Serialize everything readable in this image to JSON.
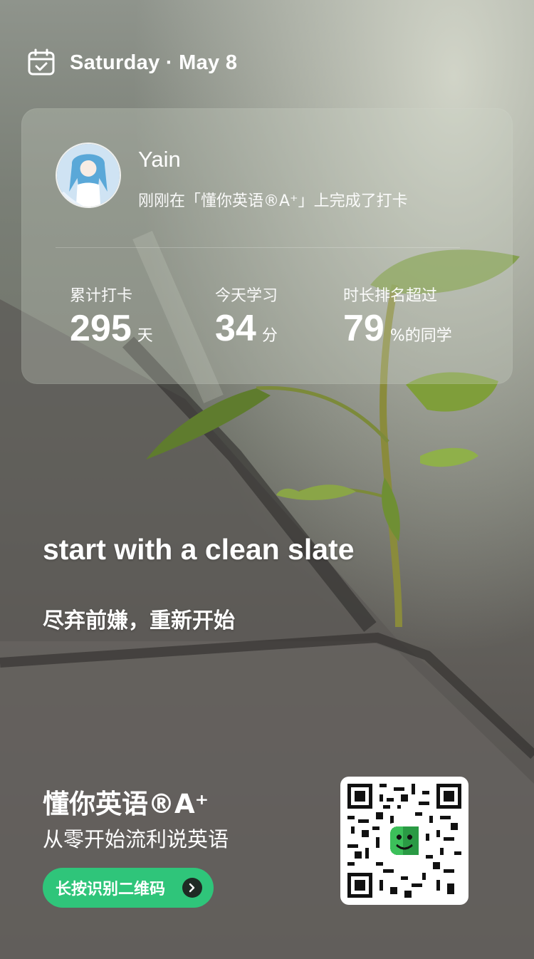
{
  "header": {
    "date": "Saturday · May 8",
    "calendar_icon": "calendar-check-icon"
  },
  "card": {
    "username": "Yain",
    "checkin_message": "刚刚在「懂你英语®A⁺」上完成了打卡",
    "stats": [
      {
        "label": "累计打卡",
        "value": "295",
        "unit": "天"
      },
      {
        "label": "今天学习",
        "value": "34",
        "unit": "分"
      },
      {
        "label": "时长排名超过",
        "value": "79",
        "unit": "%的同学"
      }
    ]
  },
  "quote": {
    "english": "start with a clean slate",
    "chinese": "尽弃前嫌，重新开始"
  },
  "brand": {
    "title": "懂你英语®A⁺",
    "subtitle": "从零开始流利说英语",
    "cta_label": "长按识别二维码",
    "cta_icon": "chevron-right-icon",
    "qr_icon": "qr-code-icon"
  },
  "colors": {
    "accent_green": "#2fc57a",
    "card_bg": "rgba(205,212,200,0.30)"
  }
}
